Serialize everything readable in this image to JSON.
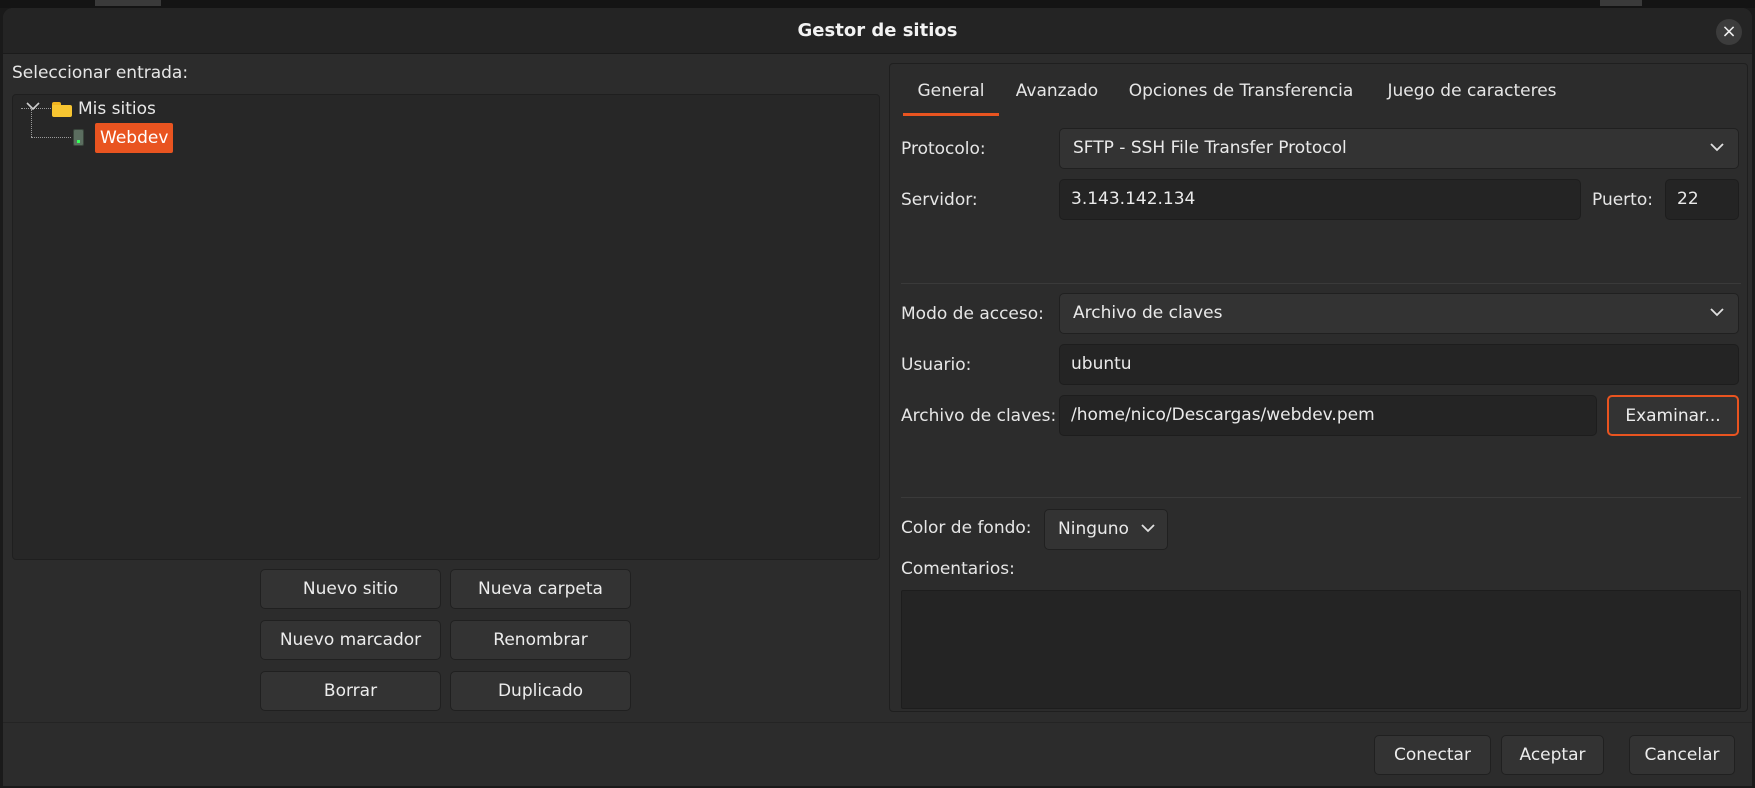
{
  "dialog": {
    "title": "Gestor de sitios"
  },
  "left": {
    "select_label": "Seleccionar entrada:",
    "tree": {
      "root_label": "Mis sitios",
      "selected_child": "Webdev"
    },
    "buttons": {
      "new_site": "Nuevo sitio",
      "new_folder": "Nueva carpeta",
      "new_bookmark": "Nuevo marcador",
      "rename": "Renombrar",
      "delete": "Borrar",
      "duplicate": "Duplicado"
    }
  },
  "tabs": [
    {
      "label": "General",
      "active": true
    },
    {
      "label": "Avanzado",
      "active": false
    },
    {
      "label": "Opciones de Transferencia",
      "active": false
    },
    {
      "label": "Juego de caracteres",
      "active": false
    }
  ],
  "general": {
    "protocol_label": "Protocolo:",
    "protocol_value": "SFTP - SSH File Transfer Protocol",
    "server_label": "Servidor:",
    "server_value": "3.143.142.134",
    "port_label": "Puerto:",
    "port_value": "22",
    "access_mode_label": "Modo de acceso:",
    "access_mode_value": "Archivo de claves",
    "user_label": "Usuario:",
    "user_value": "ubuntu",
    "keyfile_label": "Archivo de claves:",
    "keyfile_value": "/home/nico/Descargas/webdev.pem",
    "browse_label": "Examinar...",
    "bg_color_label": "Color de fondo:",
    "bg_color_value": "Ninguno",
    "comments_label": "Comentarios:"
  },
  "footer": {
    "connect": "Conectar",
    "accept": "Aceptar",
    "cancel": "Cancelar"
  },
  "colors": {
    "accent": "#e95420",
    "dialog_bg": "#2c2c2c",
    "field_bg": "#242424"
  },
  "icons": {
    "close": "close-icon",
    "expand": "chevron-down-icon",
    "folder": "folder-icon",
    "site": "server-icon",
    "dropdown": "chevron-down-icon"
  }
}
